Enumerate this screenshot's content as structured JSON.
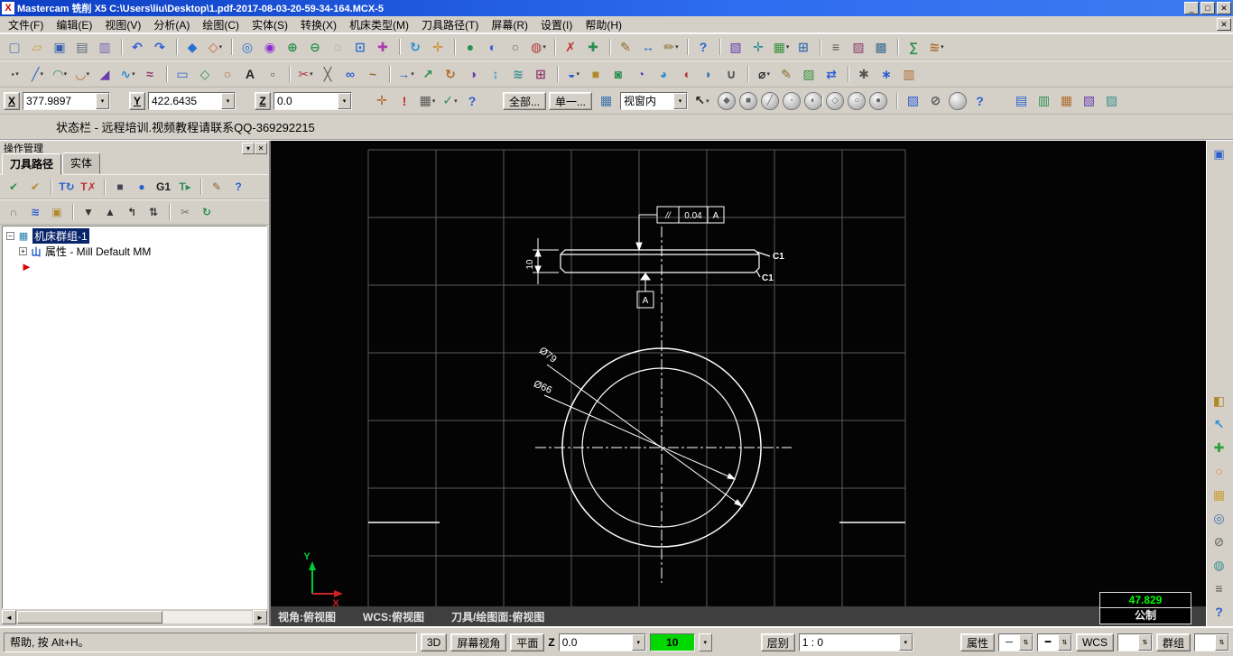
{
  "glyphs": {
    "dropdown": "▾",
    "left": "◄",
    "right": "►",
    "spinner": "⇅"
  },
  "colors": {
    "titlebar_blue": "#0d3fc4",
    "selection_blue": "#0a246a",
    "drawing_background": "#040404",
    "grid_gray": "#5a5a5a",
    "geometry_white": "#ffffff",
    "readout_green": "#00ff00",
    "z_field_yellow": "#ffffa0",
    "color_swatch_green": "#00d800",
    "axis_y_green": "#00cc33",
    "axis_x_red": "#cc2222",
    "insert_arrow_red": "#dd0000"
  },
  "window": {
    "title": "Mastercam 铣削 X5   C:\\Users\\liu\\Desktop\\1.pdf-2017-08-03-20-59-34-164.MCX-5",
    "logo_glyph": "X",
    "controls": {
      "min": "_",
      "max": "□",
      "close": "✕"
    }
  },
  "menu": {
    "child_close": "✕",
    "items": [
      {
        "name": "menu-file",
        "label": "文件(F)"
      },
      {
        "name": "menu-edit",
        "label": "编辑(E)"
      },
      {
        "name": "menu-view",
        "label": "视图(V)"
      },
      {
        "name": "menu-analyze",
        "label": "分析(A)"
      },
      {
        "name": "menu-create",
        "label": "绘图(C)"
      },
      {
        "name": "menu-solids",
        "label": "实体(S)"
      },
      {
        "name": "menu-xform",
        "label": "转换(X)"
      },
      {
        "name": "menu-machine-type",
        "label": "机床类型(M)"
      },
      {
        "name": "menu-toolpaths",
        "label": "刀具路径(T)"
      },
      {
        "name": "menu-screen",
        "label": "屏幕(R)"
      },
      {
        "name": "menu-settings",
        "label": "设置(I)"
      },
      {
        "name": "menu-help",
        "label": "帮助(H)"
      }
    ]
  },
  "toolbar_row1": {
    "icons": [
      {
        "name": "new-file-icon",
        "glyph": "▢",
        "color": "#5a78b8"
      },
      {
        "name": "open-file-icon",
        "glyph": "▱",
        "color": "#c8a23a"
      },
      {
        "name": "save-icon",
        "glyph": "▣",
        "color": "#3a5fae"
      },
      {
        "name": "print-icon",
        "glyph": "▤",
        "color": "#5a6a7a"
      },
      {
        "name": "screenshot-icon",
        "glyph": "▥",
        "color": "#7a5fae"
      },
      {
        "name": "undo-icon",
        "glyph": "↶",
        "color": "#2a5fd0",
        "gap": true
      },
      {
        "name": "redo-icon",
        "glyph": "↷",
        "color": "#2a5fd0"
      },
      {
        "name": "gview-top-icon",
        "glyph": "◆",
        "color": "#2a6fd0",
        "gap": true
      },
      {
        "name": "gview-iso-icon",
        "glyph": "◇",
        "color": "#d05f2a",
        "arrow": "▾"
      },
      {
        "name": "zoom-window-icon",
        "glyph": "◎",
        "color": "#2a6fd0",
        "gap": true
      },
      {
        "name": "zoom-target-icon",
        "glyph": "◉",
        "color": "#8a2ad0"
      },
      {
        "name": "zoom-in-icon",
        "glyph": "⊕",
        "color": "#2a8f50"
      },
      {
        "name": "zoom-out-icon",
        "glyph": "⊖",
        "color": "#2a8f50"
      },
      {
        "name": "unzoom-icon",
        "glyph": "◌",
        "color": "#888888"
      },
      {
        "name": "fit-screen-icon",
        "glyph": "⊡",
        "color": "#2a6fd0"
      },
      {
        "name": "repaint-icon",
        "glyph": "✚",
        "color": "#b03ab0"
      },
      {
        "name": "dynamic-rotate-icon",
        "glyph": "↻",
        "color": "#2a8fd0",
        "gap": true
      },
      {
        "name": "pan-icon",
        "glyph": "✛",
        "color": "#d0902a"
      },
      {
        "name": "shade-icon",
        "glyph": "●",
        "color": "#2a8f50",
        "gap": true
      },
      {
        "name": "shade-settings-icon",
        "glyph": "◐",
        "color": "#2a5fd0"
      },
      {
        "name": "wireframe-icon",
        "glyph": "○",
        "color": "#666666"
      },
      {
        "name": "blank-entity-icon",
        "glyph": "◍",
        "color": "#b03a3a",
        "arrow": "▾"
      },
      {
        "name": "delete-entity-icon",
        "glyph": "✗",
        "color": "#c03030",
        "gap": true
      },
      {
        "name": "undelete-icon",
        "glyph": "✚",
        "color": "#2a8f50"
      },
      {
        "name": "analyze-position-icon",
        "glyph": "✎",
        "color": "#8f6a2a",
        "gap": true
      },
      {
        "name": "analyze-distance-icon",
        "glyph": "↔",
        "color": "#2a5fd0"
      },
      {
        "name": "analyze-dynamic-icon",
        "glyph": "✏",
        "color": "#8f6a2a",
        "arrow": "▾"
      },
      {
        "name": "help-icon",
        "glyph": "?",
        "color": "#2a5fd0",
        "gap": true
      },
      {
        "name": "planes-icon",
        "glyph": "▧",
        "color": "#6a3aae",
        "gap": true
      },
      {
        "name": "wcs-origin-icon",
        "glyph": "✛",
        "color": "#2a8f8f"
      },
      {
        "name": "grid-settings-icon",
        "glyph": "▦",
        "color": "#3a8f3a",
        "arrow": "▾"
      },
      {
        "name": "ortho-icon",
        "glyph": "⊞",
        "color": "#3a6fae"
      },
      {
        "name": "levels-icon",
        "glyph": "≡",
        "color": "#555555",
        "gap": true
      },
      {
        "name": "attributes-icon",
        "glyph": "▨",
        "color": "#8f3a6a"
      },
      {
        "name": "groups-icon",
        "glyph": "▩",
        "color": "#3a6f8f"
      },
      {
        "name": "run-addin-icon",
        "glyph": "∑",
        "color": "#2a8f50",
        "gap": true
      },
      {
        "name": "vb-script-icon",
        "glyph": "≋",
        "color": "#b06a2a",
        "arrow": "▾"
      }
    ]
  },
  "toolbar_row2": {
    "icons": [
      {
        "name": "point-icon",
        "glyph": "∙",
        "color": "#222222",
        "arrow": "▾"
      },
      {
        "name": "line-icon",
        "glyph": "╱",
        "color": "#2a5fd0",
        "arrow": "▾"
      },
      {
        "name": "arc-icon",
        "glyph": "◠",
        "color": "#2a8f50",
        "arrow": "▾"
      },
      {
        "name": "fillet-icon",
        "glyph": "◡",
        "color": "#b06a2a",
        "arrow": "▾"
      },
      {
        "name": "chamfer-icon",
        "glyph": "◢",
        "color": "#6a3aae"
      },
      {
        "name": "spline-icon",
        "glyph": "∿",
        "color": "#2a8fd0",
        "arrow": "▾"
      },
      {
        "name": "curve-icon",
        "glyph": "≈",
        "color": "#8f3a6a"
      },
      {
        "name": "rectangle-icon",
        "glyph": "▭",
        "color": "#2a5fd0",
        "gap": true
      },
      {
        "name": "polygon-icon",
        "glyph": "◇",
        "color": "#2a8f50"
      },
      {
        "name": "ellipse-icon",
        "glyph": "○",
        "color": "#b06a2a"
      },
      {
        "name": "text-icon",
        "glyph": "A",
        "color": "#222222"
      },
      {
        "name": "bounding-box-icon",
        "glyph": "▫",
        "color": "#555555"
      },
      {
        "name": "trim-icon",
        "glyph": "✂",
        "color": "#b03a3a",
        "gap": true,
        "arrow": "▾"
      },
      {
        "name": "break-icon",
        "glyph": "╳",
        "color": "#555555"
      },
      {
        "name": "join-icon",
        "glyph": "∞",
        "color": "#2a5fd0"
      },
      {
        "name": "nurbs-modify-icon",
        "glyph": "~",
        "color": "#8f6a2a"
      },
      {
        "name": "translate-icon",
        "glyph": "→",
        "color": "#2a5fd0",
        "gap": true,
        "arrow": "▾"
      },
      {
        "name": "translate-3d-icon",
        "glyph": "↗",
        "color": "#2a8f50"
      },
      {
        "name": "rotate-icon",
        "glyph": "↻",
        "color": "#b06a2a"
      },
      {
        "name": "mirror-icon",
        "glyph": "◑",
        "color": "#6a3aae"
      },
      {
        "name": "scale-icon",
        "glyph": "↕",
        "color": "#2a8fd0"
      },
      {
        "name": "offset-icon",
        "glyph": "≋",
        "color": "#3a8f8f"
      },
      {
        "name": "array-icon",
        "glyph": "⊞",
        "color": "#8f3a6a"
      },
      {
        "name": "surface-create-icon",
        "glyph": "◒",
        "color": "#2a5fd0",
        "gap": true,
        "arrow": "▾"
      },
      {
        "name": "extrude-icon",
        "glyph": "■",
        "color": "#b0892a"
      },
      {
        "name": "revolve-icon",
        "glyph": "◙",
        "color": "#2a8f50"
      },
      {
        "name": "sweep-icon",
        "glyph": "◔",
        "color": "#6a3aae"
      },
      {
        "name": "loft-icon",
        "glyph": "◕",
        "color": "#2a8fd0"
      },
      {
        "name": "solid-fillet-icon",
        "glyph": "◖",
        "color": "#b03a3a"
      },
      {
        "name": "shell-icon",
        "glyph": "◗",
        "color": "#3a6fae"
      },
      {
        "name": "boolean-icon",
        "glyph": "∪",
        "color": "#555555"
      },
      {
        "name": "dimension-icon",
        "glyph": "⌀",
        "color": "#222222",
        "gap": true,
        "arrow": "▾"
      },
      {
        "name": "note-icon",
        "glyph": "✎",
        "color": "#8f6a2a"
      },
      {
        "name": "hatch-icon",
        "glyph": "▨",
        "color": "#3a8f3a"
      },
      {
        "name": "drafting-options-icon",
        "glyph": "⇄",
        "color": "#2a5fd0"
      },
      {
        "name": "machine-def-icon",
        "glyph": "✱",
        "color": "#555555",
        "gap": true
      },
      {
        "name": "control-def-icon",
        "glyph": "∗",
        "color": "#2a5fd0"
      },
      {
        "name": "material-icon",
        "glyph": "▥",
        "color": "#b06a2a"
      }
    ]
  },
  "ribbon": {
    "x_label": "X",
    "x_value": "377.9897",
    "y_label": "Y",
    "y_value": "422.6435",
    "z_label": "Z",
    "z_value": "0.0",
    "left_icons": [
      {
        "name": "fast-point-icon",
        "glyph": "✛",
        "color": "#b06a2a"
      },
      {
        "name": "cursor-override-icon",
        "glyph": "!",
        "color": "#c03030"
      },
      {
        "name": "autocursor-combo-icon",
        "glyph": "▦",
        "color": "#555555",
        "arrow": "▾"
      },
      {
        "name": "autocursor-check-icon",
        "glyph": "✓",
        "color": "#2a8f50",
        "arrow": "▾"
      },
      {
        "name": "help-icon",
        "glyph": "?",
        "color": "#2a5fd0"
      }
    ],
    "select_all_label": "全部...",
    "select_single_label": "单一...",
    "settings_glyph": "▦",
    "window_combo_value": "视窗内",
    "cursor_glyph": "↖",
    "circles": [
      {
        "name": "select-body-icon",
        "shape": "circle",
        "glyph": "◆",
        "color": "#666666"
      },
      {
        "name": "select-face-icon",
        "shape": "circle",
        "glyph": "■",
        "color": "#666666"
      },
      {
        "name": "select-edge-icon",
        "shape": "circle",
        "glyph": "╱",
        "color": "#666666"
      },
      {
        "name": "select-vertex-icon",
        "shape": "circle",
        "glyph": "∙",
        "color": "#666666"
      },
      {
        "name": "select-from-back-icon",
        "shape": "circle",
        "glyph": "◐",
        "color": "#666666"
      },
      {
        "name": "select-mixed-icon",
        "shape": "circle",
        "glyph": "◇",
        "color": "#666666",
        "gap": true
      },
      {
        "name": "select-in-icon",
        "shape": "circle",
        "glyph": "○",
        "color": "#666666"
      },
      {
        "name": "select-out-icon",
        "shape": "circle",
        "glyph": "●",
        "color": "#666666"
      }
    ],
    "tail_icons": [
      {
        "name": "select-validate-icon",
        "glyph": "▨",
        "color": "#2a5fd0",
        "gap": true
      },
      {
        "name": "clear-selection-icon",
        "glyph": "⊘",
        "color": "#555555"
      },
      {
        "name": "select-advanced-icon",
        "shape": "circle",
        "glyph": "",
        "color": "#666666"
      },
      {
        "name": "help-icon",
        "glyph": "?",
        "color": "#2a5fd0"
      }
    ],
    "right_icons": [
      {
        "name": "plan-view-icon",
        "glyph": "▤",
        "color": "#2a5fd0"
      },
      {
        "name": "section-view-icon",
        "glyph": "▥",
        "color": "#2a8f50"
      },
      {
        "name": "named-views-icon",
        "glyph": "▦",
        "color": "#b06a2a"
      },
      {
        "name": "viewsheet-icon",
        "glyph": "▧",
        "color": "#6a3aae"
      },
      {
        "name": "display-options-icon",
        "glyph": "▨",
        "color": "#3a8f8f"
      }
    ]
  },
  "status_banner": {
    "text": "状态栏 - 远程培训.视频教程请联系QQ-369292215"
  },
  "ops_manager": {
    "title": "操作管理",
    "collapse_glyph": "▾",
    "close_glyph": "✕",
    "tabs": {
      "toolpaths": "刀具路径",
      "solids": "实体"
    },
    "toolbar1": {
      "icons": [
        {
          "name": "select-all-ops-icon",
          "glyph": "✔",
          "color": "#2a8f50"
        },
        {
          "name": "select-dirty-ops-icon",
          "glyph": "✔",
          "color": "#b0892a"
        },
        {
          "name": "regen-selected-ops-icon",
          "glyph": "T↻",
          "color": "#2a5fd0",
          "gap": true
        },
        {
          "name": "invalidate-ops-icon",
          "glyph": "T✗",
          "color": "#c03030"
        },
        {
          "name": "backplot-icon",
          "glyph": "■",
          "color": "#444455",
          "gap": true
        },
        {
          "name": "verify-icon",
          "glyph": "●",
          "color": "#2a5fd0"
        },
        {
          "name": "post-g1-icon",
          "glyph": "G1",
          "color": "#222222"
        },
        {
          "name": "high-feed-icon",
          "glyph": "T▸",
          "color": "#2a8f50"
        },
        {
          "name": "edit-ops-icon",
          "glyph": "✎",
          "color": "#8f6a2a",
          "gap": true
        },
        {
          "name": "help-icon",
          "glyph": "?",
          "color": "#2a5fd0"
        }
      ]
    },
    "toolbar2": {
      "icons": [
        {
          "name": "lock-ops-icon",
          "glyph": "∩",
          "color": "#777777"
        },
        {
          "name": "toolpath-display-icon",
          "glyph": "≋",
          "color": "#2a5fd0"
        },
        {
          "name": "gouge-check-icon",
          "glyph": "▣",
          "color": "#b0892a"
        },
        {
          "name": "move-insert-down-icon",
          "glyph": "▼",
          "color": "#333333",
          "gap": true
        },
        {
          "name": "move-insert-up-icon",
          "glyph": "▲",
          "color": "#333333"
        },
        {
          "name": "insert-above-icon",
          "glyph": "↰",
          "color": "#333333"
        },
        {
          "name": "scroll-insert-icon",
          "glyph": "⇅",
          "color": "#333333"
        },
        {
          "name": "cut-ops-icon",
          "glyph": "✂",
          "color": "#777777",
          "gap": true
        },
        {
          "name": "recalc-icon",
          "glyph": "↻",
          "color": "#2a8f50"
        }
      ]
    },
    "tree": {
      "expand_open": "−",
      "expand_closed": "+",
      "group_icon_glyph": "▦",
      "group_label": "机床群组-1",
      "prop_icon_glyph": "山",
      "properties_label": "属性 - Mill Default MM",
      "insert_marker": "►"
    }
  },
  "drawing": {
    "annotations": {
      "tol_sym": "//",
      "tol_value": "0.04",
      "tol_datum": "A",
      "datum_label": "A",
      "chamfer_top": "C1",
      "chamfer_bottom": "C1",
      "dia_outer": "Ø79",
      "dia_inner": "Ø66",
      "thickness": "10",
      "axis_x": "X",
      "axis_y": "Y"
    },
    "status": {
      "view": "视角:俯视图",
      "wcs": "WCS:俯视图",
      "cplane": "刀具/绘图面:俯视图",
      "coord": "47.829",
      "units": "公制"
    }
  },
  "right_toolbar": {
    "top_icon": {
      "glyph": "▣"
    },
    "icons": [
      {
        "name": "clear-colors-icon",
        "glyph": "◧",
        "color": "#b0892a"
      },
      {
        "name": "select-pointer-icon",
        "glyph": "↖",
        "color": "#2a8fd0"
      },
      {
        "name": "undelete-icon",
        "glyph": "✚",
        "color": "#2a9f3a"
      },
      {
        "name": "circle-select-icon",
        "glyph": "○",
        "color": "#d08a2a"
      },
      {
        "name": "grid-display-icon",
        "glyph": "▦",
        "color": "#c8a23a"
      },
      {
        "name": "magnify-icon",
        "glyph": "◎",
        "color": "#3a6fae"
      },
      {
        "name": "blank-entities-icon",
        "glyph": "⊘",
        "color": "#777777"
      },
      {
        "name": "shade-toggle-icon",
        "glyph": "◍",
        "color": "#3a8f8f"
      },
      {
        "name": "levels-panel-icon",
        "glyph": "≡",
        "color": "#555555"
      },
      {
        "name": "help-icon",
        "glyph": "?",
        "color": "#2a5fd0"
      }
    ]
  },
  "bottom_bar": {
    "help_text": "帮助, 按 Alt+H。",
    "btn_3d": "3D",
    "btn_screen_view": "屏幕视角",
    "btn_plane": "平面",
    "z_label": "Z",
    "z_value": "0.0",
    "color_value": "10",
    "level_label": "层别",
    "level_value": "1 : 0",
    "attr_label": "属性",
    "linestyle_value": "─",
    "linewidth_value": "━",
    "wcs_label": "WCS",
    "group_label": "群组"
  }
}
